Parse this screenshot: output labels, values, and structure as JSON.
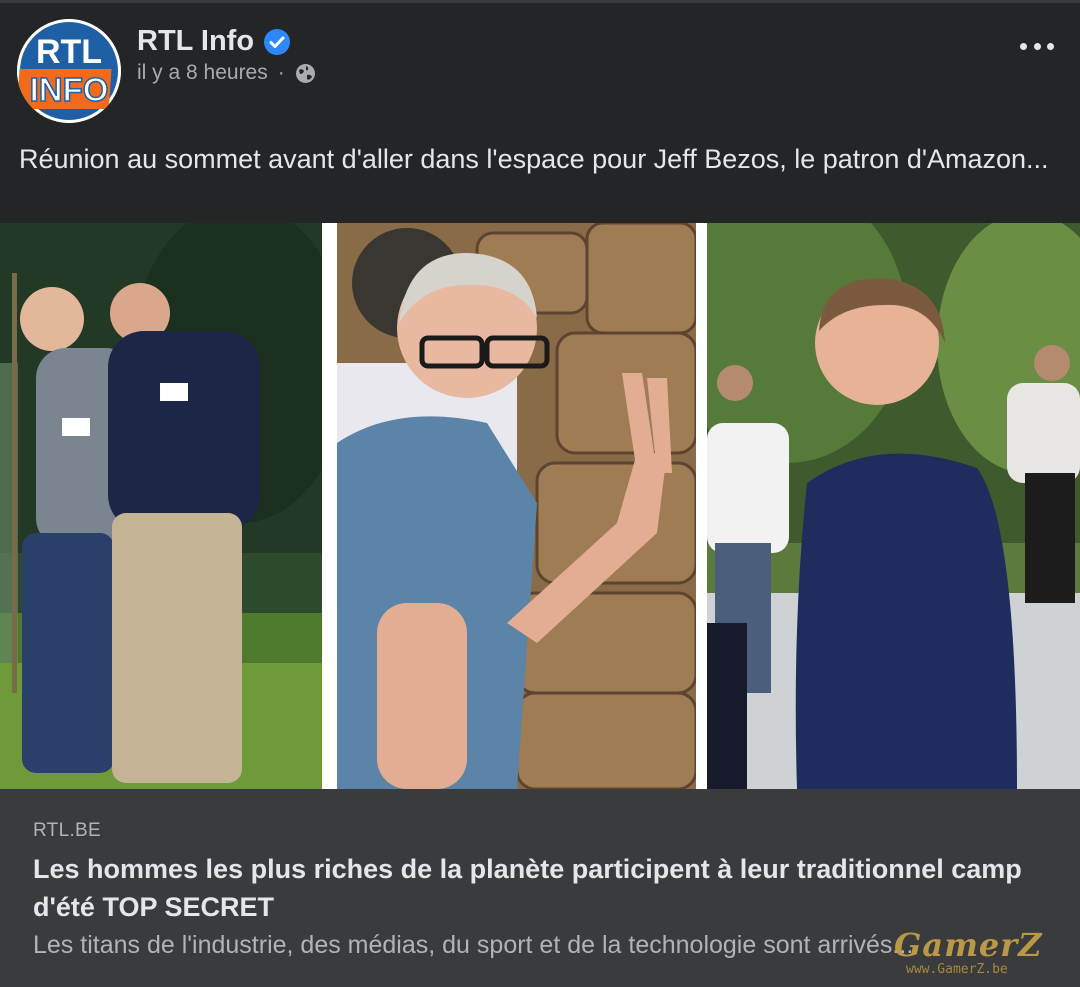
{
  "header": {
    "page_name": "RTL Info",
    "timestamp": "il y a 8 heures",
    "separator": "·",
    "avatar_text_top": "RTL",
    "avatar_text_bottom": "INFO"
  },
  "caption": "Réunion au sommet avant d'aller dans l'espace pour Jeff Bezos, le patron d'Amazon...",
  "link_preview": {
    "domain": "RTL.BE",
    "title": "Les hommes les plus riches de la planète participent à leur traditionnel camp d'été TOP SECRET",
    "description": "Les titans de l'industrie, des médias, du sport et de la technologie sont arrivés..."
  },
  "watermark": {
    "text": "GamerZ",
    "url": "www.GamerZ.be"
  },
  "colors": {
    "background": "#242526",
    "link_card": "#3a3b3c",
    "verified": "#2d88ff",
    "rtl_blue": "#1f5fa6",
    "rtl_orange": "#f26a1b"
  },
  "icons": {
    "verified": "verified-badge-icon",
    "privacy": "globe-icon",
    "more": "more-options-icon"
  }
}
